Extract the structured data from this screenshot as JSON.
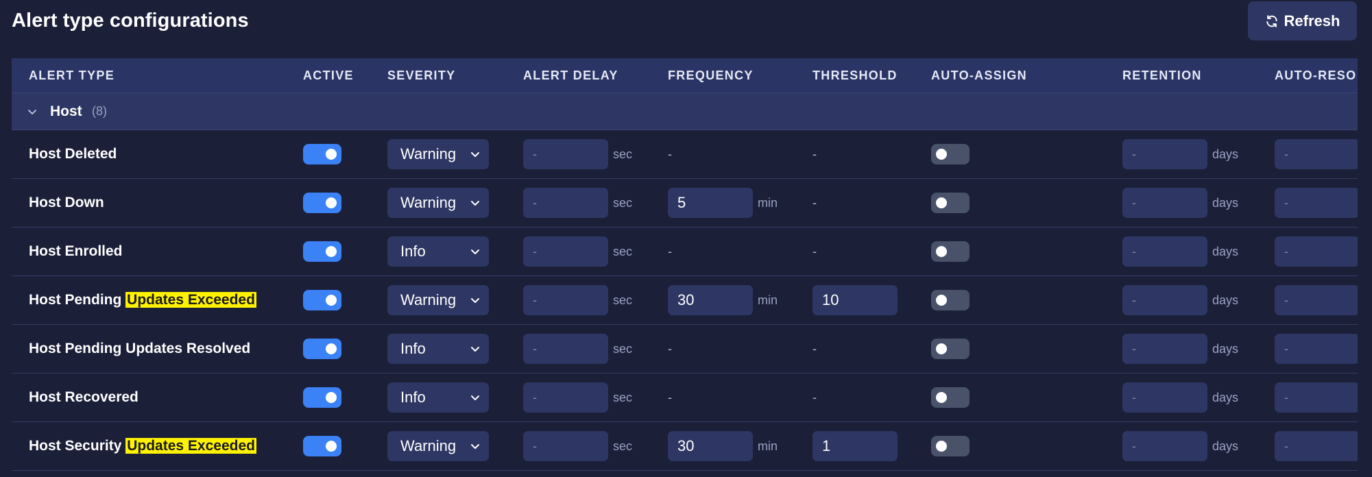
{
  "page": {
    "title": "Alert type configurations",
    "refresh_label": "Refresh"
  },
  "table": {
    "columns": [
      "ALERT TYPE",
      "ACTIVE",
      "SEVERITY",
      "ALERT DELAY",
      "FREQUENCY",
      "THRESHOLD",
      "AUTO-ASSIGN",
      "RETENTION",
      "AUTO-RESO"
    ],
    "group": {
      "label": "Host",
      "count": "(8)"
    },
    "rows": [
      {
        "name": "Host Deleted",
        "name_highlight": "",
        "active": true,
        "severity": "Warning",
        "alert_delay": "-",
        "delay_unit": "sec",
        "frequency": "-",
        "frequency_unit": "",
        "threshold": "-",
        "auto_assign": false,
        "retention": "-",
        "retention_unit": "days",
        "auto_resolve": "-"
      },
      {
        "name": "Host Down",
        "name_highlight": "",
        "active": true,
        "severity": "Warning",
        "alert_delay": "-",
        "delay_unit": "sec",
        "frequency": "5",
        "frequency_unit": "min",
        "threshold": "-",
        "auto_assign": false,
        "retention": "-",
        "retention_unit": "days",
        "auto_resolve": "-"
      },
      {
        "name": "Host Enrolled",
        "name_highlight": "",
        "active": true,
        "severity": "Info",
        "alert_delay": "-",
        "delay_unit": "sec",
        "frequency": "-",
        "frequency_unit": "",
        "threshold": "-",
        "auto_assign": false,
        "retention": "-",
        "retention_unit": "days",
        "auto_resolve": "-"
      },
      {
        "name": "Host Pending ",
        "name_highlight": "Updates Exceeded",
        "active": true,
        "severity": "Warning",
        "alert_delay": "-",
        "delay_unit": "sec",
        "frequency": "30",
        "frequency_unit": "min",
        "threshold": "10",
        "auto_assign": false,
        "retention": "-",
        "retention_unit": "days",
        "auto_resolve": "-"
      },
      {
        "name": "Host Pending Updates Resolved",
        "name_highlight": "",
        "active": true,
        "severity": "Info",
        "alert_delay": "-",
        "delay_unit": "sec",
        "frequency": "-",
        "frequency_unit": "",
        "threshold": "-",
        "auto_assign": false,
        "retention": "-",
        "retention_unit": "days",
        "auto_resolve": "-"
      },
      {
        "name": "Host Recovered",
        "name_highlight": "",
        "active": true,
        "severity": "Info",
        "alert_delay": "-",
        "delay_unit": "sec",
        "frequency": "-",
        "frequency_unit": "",
        "threshold": "-",
        "auto_assign": false,
        "retention": "-",
        "retention_unit": "days",
        "auto_resolve": "-"
      },
      {
        "name": "Host Security ",
        "name_highlight": "Updates Exceeded",
        "active": true,
        "severity": "Warning",
        "alert_delay": "-",
        "delay_unit": "sec",
        "frequency": "30",
        "frequency_unit": "min",
        "threshold": "1",
        "auto_assign": false,
        "retention": "-",
        "retention_unit": "days",
        "auto_resolve": "-"
      }
    ]
  },
  "icons": {
    "refresh": "refresh-icon",
    "group_toggle": "chevron-down-icon",
    "select_arrow": "chevron-down-icon"
  },
  "colors": {
    "background": "#1b1f38",
    "header": "#2a3566",
    "toggle_on": "#3b82f6",
    "toggle_off": "#4a5269",
    "highlight": "#fff200"
  }
}
